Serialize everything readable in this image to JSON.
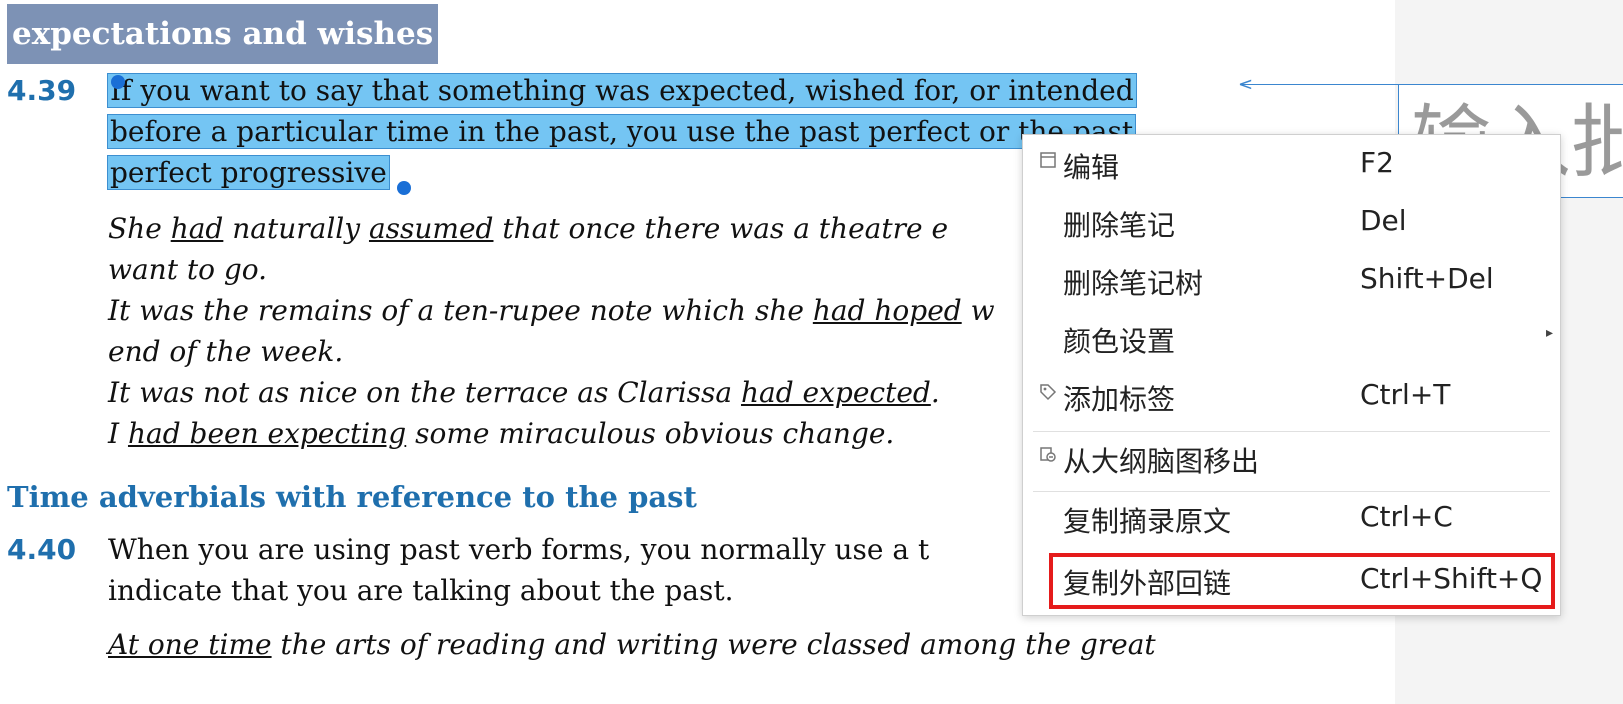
{
  "document": {
    "section_heading": "expectations and wishes",
    "para_439": {
      "number": "4.39",
      "lines": [
        "If you want to say that something was expected, wished for, or intended",
        "before a particular time in the past, you use the past perfect or the past",
        "perfect progressive"
      ]
    },
    "examples_439": {
      "e1": {
        "a": "She ",
        "b": "had",
        "c": "  naturally ",
        "d": "assumed",
        "e": "  that  once  there  was  a  theatre  e"
      },
      "e1b": "want to go.",
      "e2": {
        "a": "It was the remains of a ten-rupee note which she ",
        "b": "had hoped",
        "c": " w"
      },
      "e2b": "end of the week.",
      "e3": {
        "a": "It was not as nice on the terrace as Clarissa ",
        "b": "had expected",
        "c": "."
      },
      "e4": {
        "a": "I ",
        "b": "had been expecting",
        "c": " some miraculous obvious change."
      }
    },
    "subheading": "Time adverbials with reference to the past",
    "para_440": {
      "number": "4.40",
      "line1": " When you are using past verb forms, you normally use a t",
      "line2": "indicate that you are talking about the past."
    },
    "example_440": {
      "a": "At  one  time",
      "b": "  the  arts  of  reading  and  writing  were  classed  among  the  great"
    }
  },
  "annotation": {
    "placeholder": "输入批"
  },
  "context_menu": {
    "items": [
      {
        "label": "编辑",
        "shortcut": "F2",
        "icon": "window-icon"
      },
      {
        "label": "删除笔记",
        "shortcut": "Del"
      },
      {
        "label": "删除笔记树",
        "shortcut": "Shift+Del"
      },
      {
        "label": "颜色设置",
        "shortcut": "",
        "submenu": "▸"
      },
      {
        "label": "添加标签",
        "shortcut": "Ctrl+T",
        "icon": "tag-icon"
      },
      {
        "label": "从大纲脑图移出",
        "shortcut": "",
        "icon": "remove-from-outline-icon"
      },
      {
        "label": "复制摘录原文",
        "shortcut": "Ctrl+C"
      },
      {
        "label": "复制外部回链",
        "shortcut": "Ctrl+Shift+Q"
      }
    ]
  },
  "colors": {
    "accent": "#1f6fad",
    "selection": "#74c5f3",
    "highlight_outline": "#e51b1b"
  }
}
